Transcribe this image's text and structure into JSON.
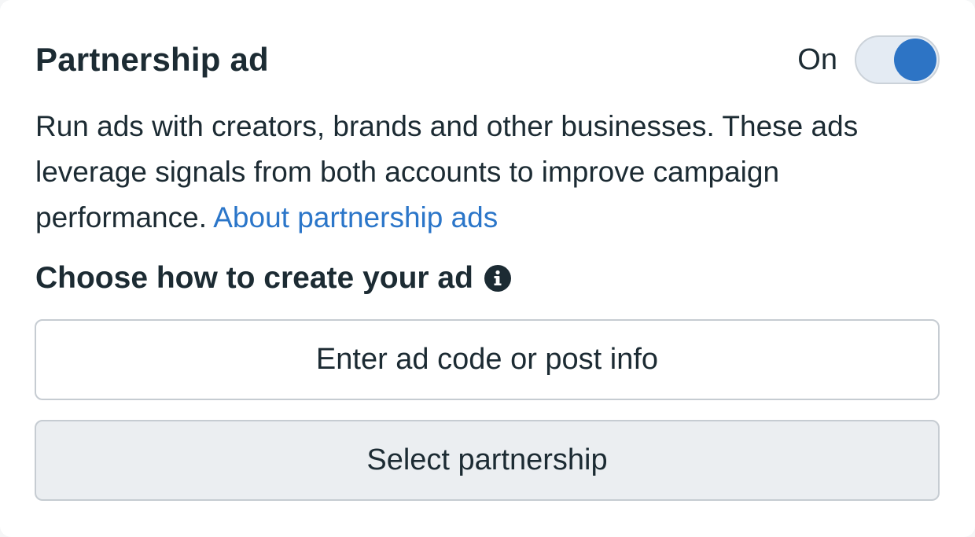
{
  "header": {
    "title": "Partnership ad",
    "toggle_label": "On",
    "toggle_state": "on"
  },
  "description": {
    "text": "Run ads with creators, brands and other businesses. These ads leverage signals from both accounts to improve campaign performance. ",
    "link_label": "About partnership ads"
  },
  "section": {
    "heading": "Choose how to create your ad",
    "icon": "info-icon"
  },
  "buttons": {
    "enter_code_label": "Enter ad code or post info",
    "select_partnership_label": "Select partnership"
  },
  "colors": {
    "accent": "#2d74c5",
    "link": "#2b76c9",
    "text": "#1c2b33",
    "secondary_button_bg": "#ebeef1"
  }
}
